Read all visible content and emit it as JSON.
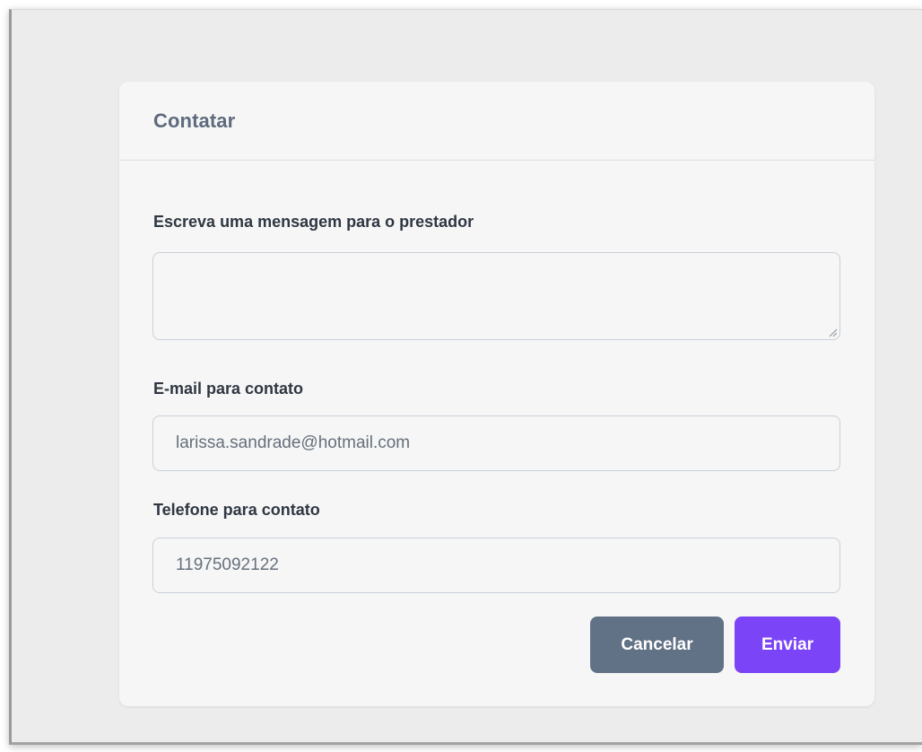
{
  "dialog": {
    "title": "Contatar"
  },
  "form": {
    "message": {
      "label": "Escreva uma mensagem para o prestador",
      "value": ""
    },
    "email": {
      "label": "E-mail para contato",
      "value": "larissa.sandrade@hotmail.com"
    },
    "phone": {
      "label": "Telefone para contato",
      "value": "11975092122"
    }
  },
  "actions": {
    "cancel_label": "Cancelar",
    "send_label": "Enviar"
  },
  "colors": {
    "accent": "#7b45f7",
    "secondary_button": "#627286",
    "title": "#5e6b7c",
    "label": "#2f3742"
  },
  "icons": {
    "textarea_resize": "resize-handle-icon"
  }
}
